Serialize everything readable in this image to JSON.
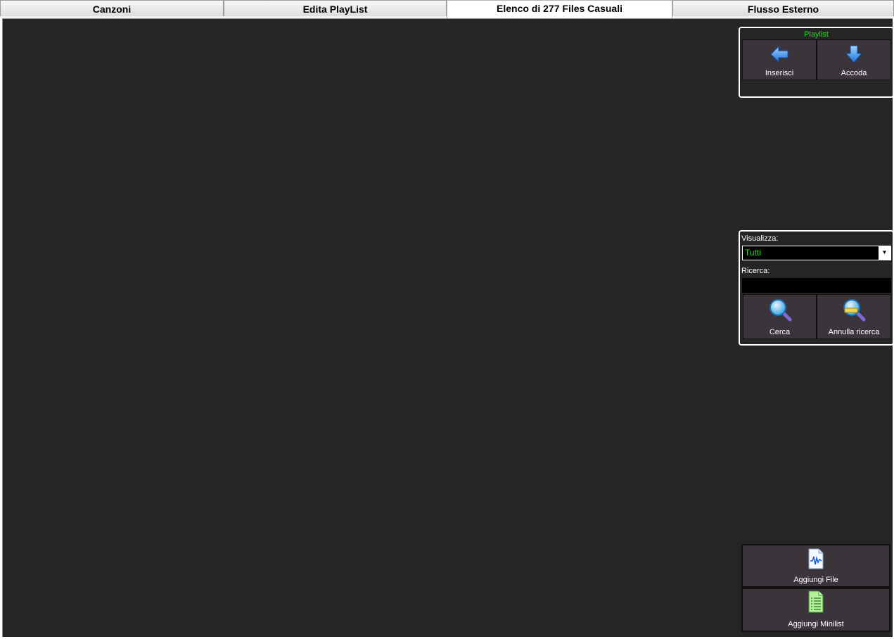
{
  "tabs": [
    {
      "label": "Canzoni"
    },
    {
      "label": "Edita PlayList"
    },
    {
      "label": "Elenco di 277 Files Casuali"
    },
    {
      "label": "Flusso Esterno"
    }
  ],
  "playlist_panel": {
    "title": "Playlist",
    "insert_label": "Inserisci",
    "append_label": "Accoda"
  },
  "filter_panel": {
    "view_label": "Visualizza:",
    "view_value": "Tutti",
    "search_label": "Ricerca:",
    "search_value": "",
    "search_button": "Cerca",
    "cancel_search_button": "Annulla ricerca"
  },
  "add_panel": {
    "add_file_label": "Aggiungi File",
    "add_minilist_label": "Aggiungi Minilist"
  },
  "colors": {
    "background": "#252525",
    "accent_green": "#23e01f",
    "button_bg": "#3b353b"
  }
}
